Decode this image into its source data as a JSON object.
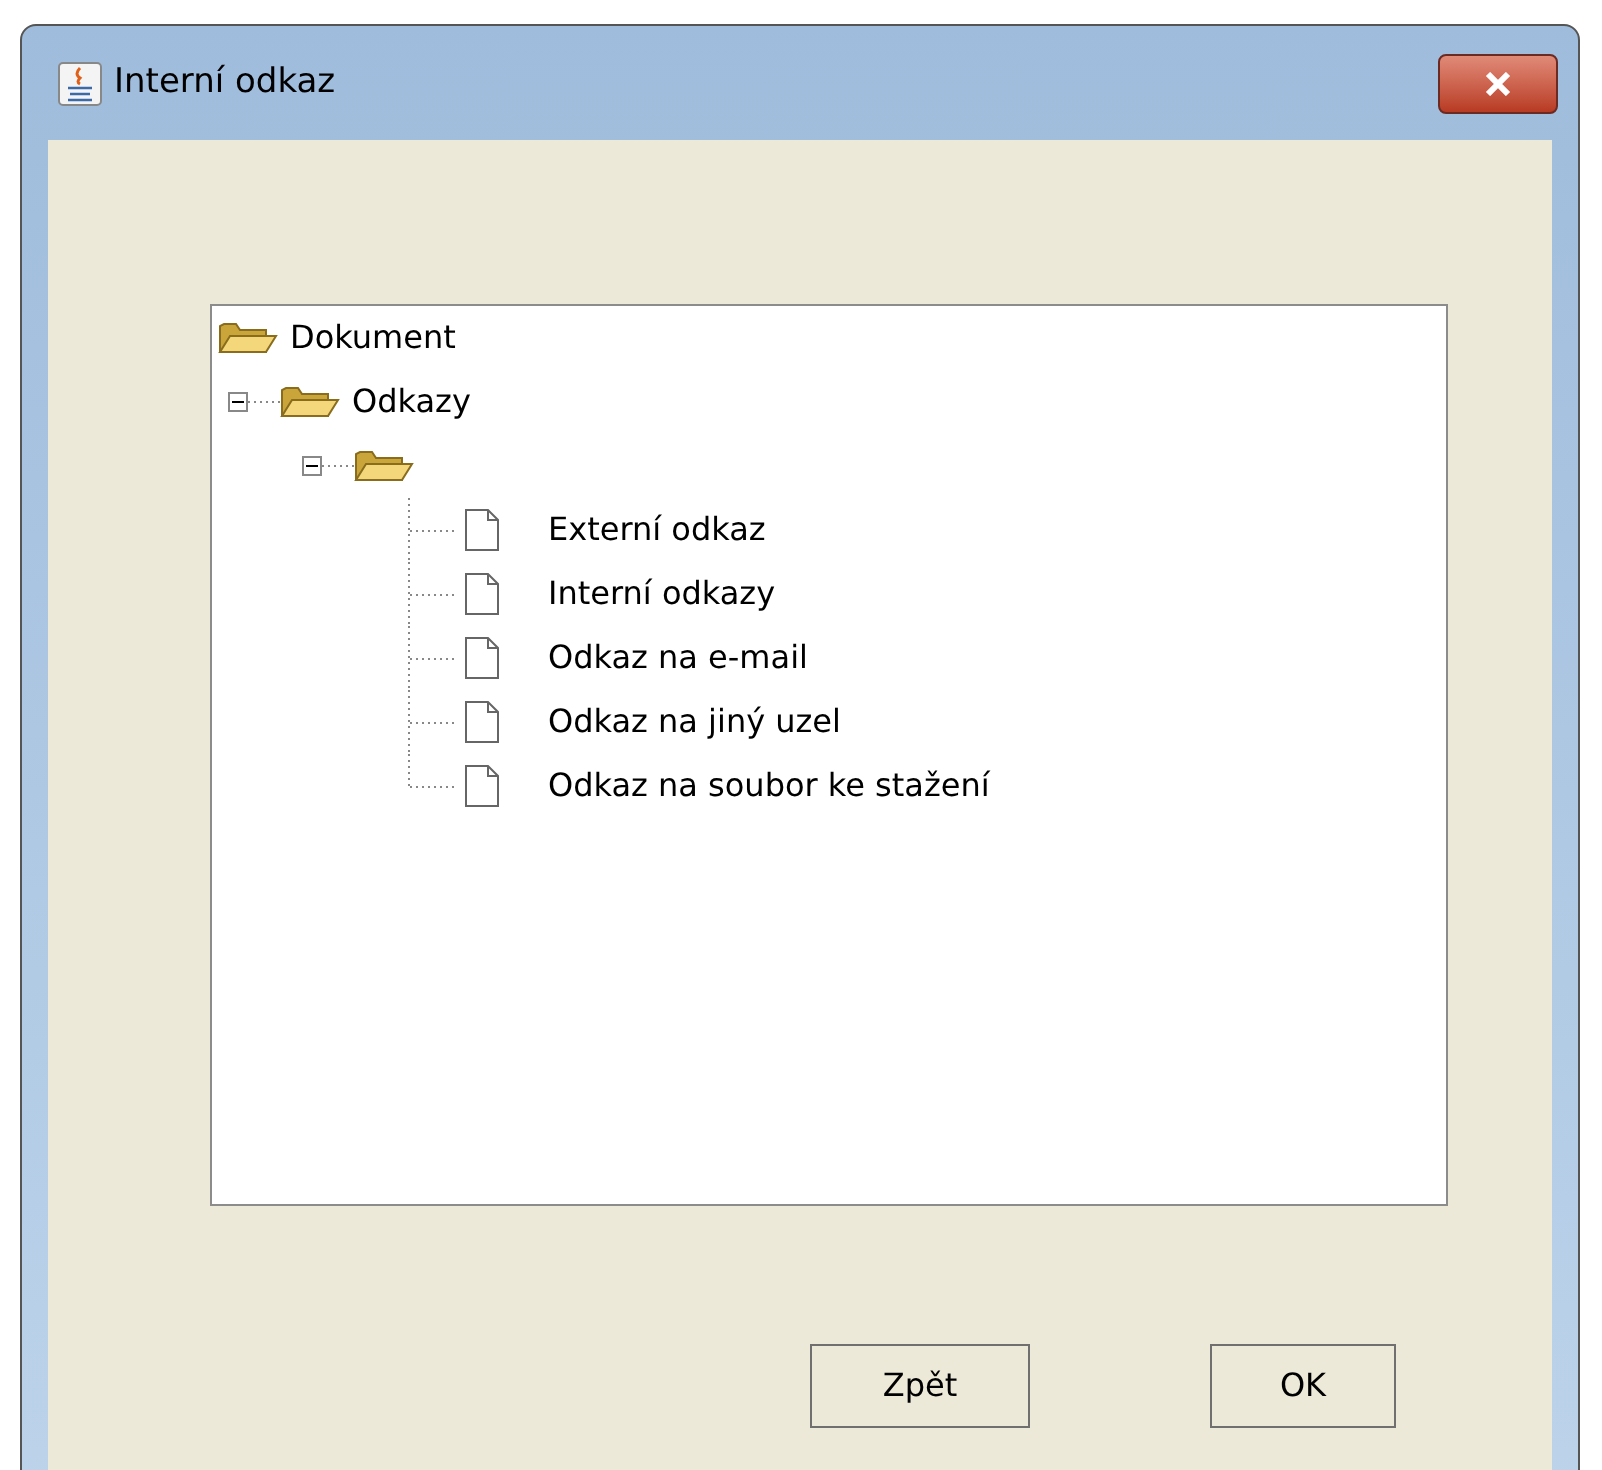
{
  "window": {
    "title": "Interní odkaz"
  },
  "tree": [
    {
      "kind": "folder",
      "label": "Dokument",
      "children": [
        {
          "kind": "folder",
          "label": "Odkazy",
          "expanded": true,
          "children": [
            {
              "kind": "folder",
              "expanded": true,
              "children": [
                {
                  "kind": "document",
                  "label": "Externí odkaz"
                },
                {
                  "kind": "document",
                  "label": "Interní odkazy"
                },
                {
                  "kind": "document",
                  "label": "Odkaz na e-mail"
                },
                {
                  "kind": "document",
                  "label": "Odkaz na jiný uzel"
                },
                {
                  "kind": "document",
                  "label": "Odkaz na soubor ke stažení"
                }
              ]
            }
          ]
        }
      ]
    }
  ],
  "buttons": [
    "Zpět",
    "OK"
  ]
}
